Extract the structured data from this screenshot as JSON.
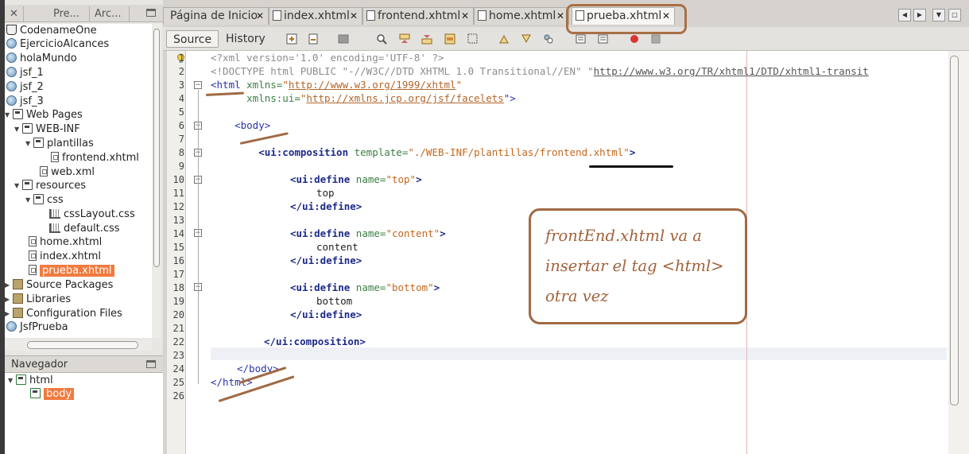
{
  "project_panel": {
    "tabs": [
      "Pre...",
      "Arc..."
    ],
    "tree": [
      {
        "label": "CodenameOne",
        "icon": "cup-icon"
      },
      {
        "label": "EjercicioAlcances",
        "icon": "globe-icon"
      },
      {
        "label": "holaMundo",
        "icon": "globe-icon"
      },
      {
        "label": "jsf_1",
        "icon": "globe-icon"
      },
      {
        "label": "jsf_2",
        "icon": "globe-icon"
      },
      {
        "label": "jsf_3",
        "icon": "globe-icon"
      },
      {
        "label": "Web Pages",
        "icon": "folder-icon"
      },
      {
        "label": "WEB-INF",
        "icon": "folder-icon"
      },
      {
        "label": "plantillas",
        "icon": "folder-icon"
      },
      {
        "label": "frontend.xhtml",
        "icon": "file-icon"
      },
      {
        "label": "web.xml",
        "icon": "file-icon"
      },
      {
        "label": "resources",
        "icon": "folder-icon"
      },
      {
        "label": "css",
        "icon": "folder-icon"
      },
      {
        "label": "cssLayout.css",
        "icon": "css-icon"
      },
      {
        "label": "default.css",
        "icon": "css-icon"
      },
      {
        "label": "home.xhtml",
        "icon": "file-icon"
      },
      {
        "label": "index.xhtml",
        "icon": "file-icon"
      },
      {
        "label": "prueba.xhtml",
        "icon": "file-icon"
      },
      {
        "label": "Source Packages",
        "icon": "package-icon"
      },
      {
        "label": "Libraries",
        "icon": "package-icon"
      },
      {
        "label": "Configuration Files",
        "icon": "package-icon"
      },
      {
        "label": "JsfPrueba",
        "icon": "globe-icon"
      }
    ]
  },
  "navigator": {
    "title": "Navegador",
    "nodes": [
      "html",
      "body"
    ]
  },
  "editor_tabs": [
    "Página de Inicio",
    "index.xhtml",
    "frontend.xhtml",
    "home.xhtml",
    "prueba.xhtml"
  ],
  "toolbar": {
    "source_label": "Source",
    "history_label": "History"
  },
  "line_numbers": [
    "1",
    "2",
    "3",
    "4",
    "5",
    "6",
    "7",
    "8",
    "9",
    "10",
    "11",
    "12",
    "13",
    "14",
    "15",
    "16",
    "17",
    "18",
    "19",
    "20",
    "21",
    "22",
    "23",
    "24",
    "25",
    "26"
  ],
  "code": {
    "l1": "<?xml version='1.0' encoding='UTF-8' ?>",
    "l2a": "<!DOCTYPE html PUBLIC \"-//W3C//DTD XHTML 1.0 Transitional//EN\" \"",
    "l2b": "http://www.w3.org/TR/xhtml1/DTD/xhtml1-transit",
    "l3a": "<html ",
    "l3b": "xmlns=",
    "l3c": "\"",
    "l3d": "http://www.w3.org/1999/xhtml",
    "l3e": "\"",
    "l4a": "      xmlns:ui=",
    "l4b": "\"",
    "l4c": "http://xmlns.jcp.org/jsf/facelets",
    "l4d": "\">",
    "l6": "    <body>",
    "l8a": "        <ui:composition ",
    "l8b": "template=",
    "l8c": "\"./WEB-INF/plantillas/frontend.xhtml\"",
    "l8d": ">",
    "def_open": "<ui:define ",
    "def_attr": "name=",
    "def_close": "</ui:define>",
    "top_val": "\"top\"",
    "top_text": "top",
    "content_val": "\"content\"",
    "content_text": "content",
    "bottom_val": "\"bottom\"",
    "bottom_text": "bottom",
    "comp_close": "</ui:composition>",
    "body_close": "</body>",
    "html_close": "</html>",
    "gt": ">"
  },
  "annotation": {
    "lines": [
      "frontEnd.xhtml va a",
      "insertar el tag <html>",
      "otra vez"
    ],
    "color": "#a0623b"
  }
}
